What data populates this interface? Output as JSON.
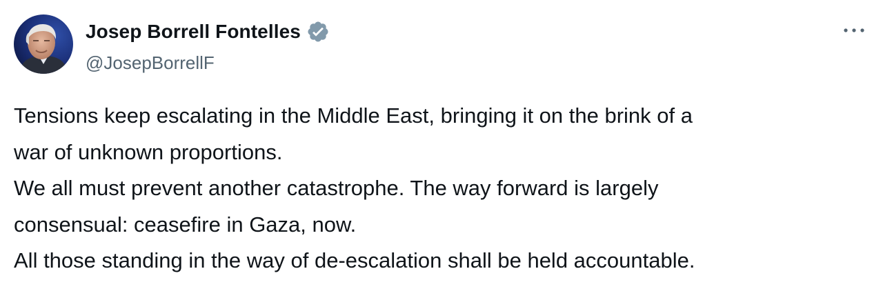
{
  "author": {
    "display_name": "Josep Borrell Fontelles",
    "handle": "@JosepBorrellF",
    "verified_badge_color": "#829aab"
  },
  "tweet": {
    "lines": [
      "Tensions keep escalating in the Middle East, bringing it on the brink of a",
      "war of unknown proportions.",
      "We all must prevent another catastrophe. The way forward is largely",
      "consensual: ceasefire in Gaza, now.",
      "All those standing in the way of de-escalation shall be held accountable."
    ]
  },
  "icons": {
    "more": "more-horizontal-icon",
    "verified": "verified-badge-icon"
  },
  "colors": {
    "text_primary": "#0f1419",
    "text_secondary": "#536471",
    "background": "#ffffff"
  }
}
